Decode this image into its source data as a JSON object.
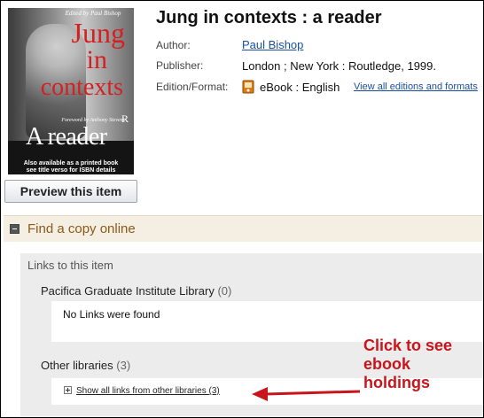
{
  "book": {
    "title": "Jung in contexts : a reader",
    "cover": {
      "tagline": "Edited by Paul Bishop",
      "title_line1": "Jung",
      "title_line2": "in",
      "title_line3": "contexts",
      "foreword": "Foreword by Anthony Stevens",
      "subtitle": "A reader",
      "registered_mark": "R",
      "note_line1": "Also available as a printed book",
      "note_line2": "see title verso for ISBN details"
    },
    "preview_button": "Preview this item",
    "author_label": "Author:",
    "author": "Paul Bishop",
    "publisher_label": "Publisher:",
    "publisher": "London ; New York : Routledge, 1999.",
    "edition_label": "Edition/Format:",
    "edition": "eBook : English",
    "editions_link": "View all editions and formats"
  },
  "find_copy": {
    "title": "Find a copy online",
    "links_header": "Links to this item",
    "library_name": "Pacifica Graduate Institute Library",
    "library_count": "(0)",
    "no_links": "No Links were found",
    "other_libraries": "Other libraries",
    "other_count": "(3)",
    "show_links": "Show all links from other libraries (3)"
  },
  "annotation": {
    "text": "Click to see ebook holdings",
    "color": "#c8151b"
  },
  "colors": {
    "link": "#1a4fa0",
    "find_title": "#8a5a1a",
    "cover_title": "#d42020"
  }
}
